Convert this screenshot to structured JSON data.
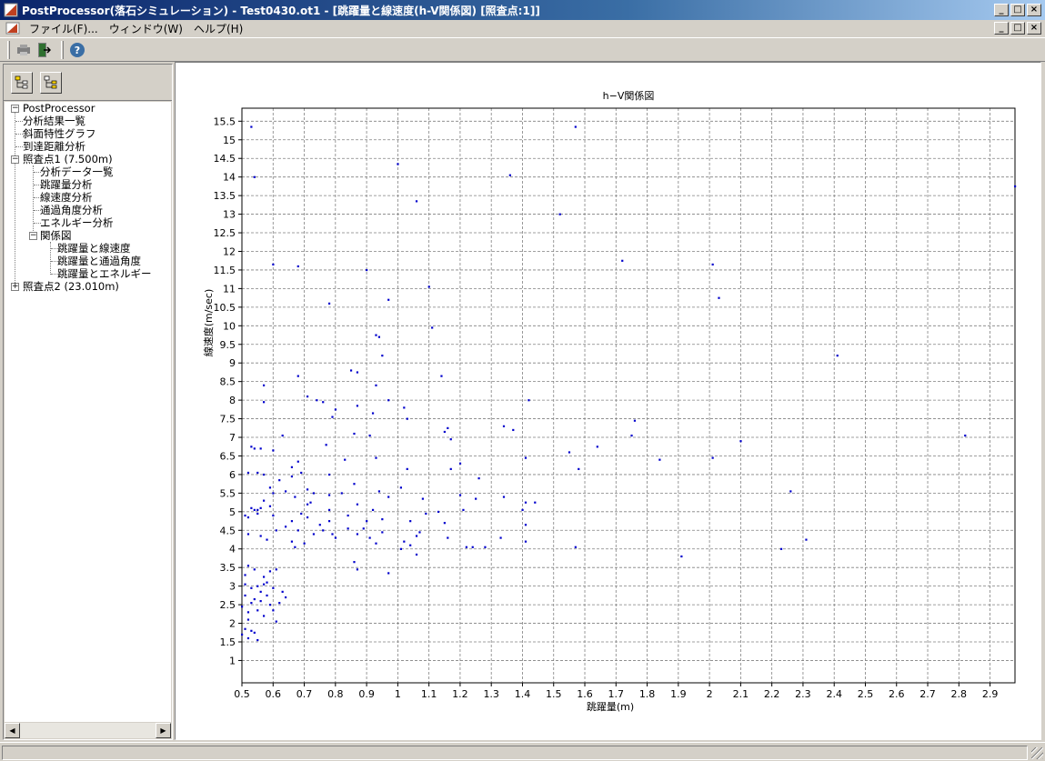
{
  "window": {
    "title": "PostProcessor(落石シミュレーション) - Test0430.ot1 - [跳躍量と線速度(h-V関係図) [照査点:1]]",
    "minimize": "_",
    "maximize": "□",
    "close": "×"
  },
  "menubar": {
    "items": [
      "ファイル(F)...",
      "ウィンドウ(W)",
      "ヘルプ(H)"
    ]
  },
  "toolbar": {
    "icons": [
      "print-icon",
      "exit-icon",
      "help-icon"
    ],
    "help_glyph": "?"
  },
  "tree": {
    "root": "PostProcessor",
    "items": [
      {
        "label": "分析結果一覧",
        "level": 1
      },
      {
        "label": "斜面特性グラフ",
        "level": 1
      },
      {
        "label": "到達距離分析",
        "level": 1
      },
      {
        "label": "照査点1 (7.500m)",
        "level": 1,
        "expanded": true
      },
      {
        "label": "分析データ一覧",
        "level": 2
      },
      {
        "label": "跳躍量分析",
        "level": 2
      },
      {
        "label": "線速度分析",
        "level": 2
      },
      {
        "label": "通過角度分析",
        "level": 2
      },
      {
        "label": "エネルギー分析",
        "level": 2
      },
      {
        "label": "関係図",
        "level": 2,
        "expanded": true
      },
      {
        "label": "跳躍量と線速度",
        "level": 3
      },
      {
        "label": "跳躍量と通過角度",
        "level": 3
      },
      {
        "label": "跳躍量とエネルギー",
        "level": 3
      },
      {
        "label": "照査点2 (23.010m)",
        "level": 1,
        "expanded": false
      }
    ],
    "toggle_expanded": "−",
    "toggle_collapsed": "+"
  },
  "colors": {
    "point": "#0000cc",
    "grid": "#808080",
    "titlebar": "#0a246a"
  },
  "chart_data": {
    "type": "scatter",
    "title": "h−V関係図",
    "xlabel": "跳躍量(m)",
    "ylabel": "線速度(m/sec)",
    "xlim": [
      0.5,
      2.98
    ],
    "ylim": [
      0.4,
      15.85
    ],
    "xticks": [
      "0.5",
      "0.6",
      "0.7",
      "0.8",
      "0.9",
      "1",
      "1.1",
      "1.2",
      "1.3",
      "1.4",
      "1.5",
      "1.6",
      "1.7",
      "1.8",
      "1.9",
      "2",
      "2.1",
      "2.2",
      "2.3",
      "2.4",
      "2.5",
      "2.6",
      "2.7",
      "2.8",
      "2.9"
    ],
    "yticks": [
      "1",
      "1.5",
      "2",
      "2.5",
      "3",
      "3.5",
      "4",
      "4.5",
      "5",
      "5.5",
      "6",
      "6.5",
      "7",
      "7.5",
      "8",
      "8.5",
      "9",
      "9.5",
      "10",
      "10.5",
      "11",
      "11.5",
      "12",
      "12.5",
      "13",
      "13.5",
      "14",
      "14.5",
      "15",
      "15.5"
    ],
    "grid": true,
    "points": [
      [
        0.53,
        15.35
      ],
      [
        1.57,
        15.35
      ],
      [
        0.54,
        14.0
      ],
      [
        1.0,
        14.35
      ],
      [
        1.36,
        14.05
      ],
      [
        1.06,
        13.35
      ],
      [
        1.52,
        13.0
      ],
      [
        2.98,
        13.75
      ],
      [
        0.6,
        11.65
      ],
      [
        0.68,
        11.6
      ],
      [
        0.9,
        11.5
      ],
      [
        1.1,
        11.05
      ],
      [
        1.72,
        11.75
      ],
      [
        2.01,
        11.65
      ],
      [
        2.03,
        10.75
      ],
      [
        0.97,
        10.7
      ],
      [
        0.78,
        10.6
      ],
      [
        1.11,
        9.95
      ],
      [
        0.93,
        9.75
      ],
      [
        0.94,
        9.7
      ],
      [
        0.95,
        9.2
      ],
      [
        2.41,
        9.2
      ],
      [
        0.85,
        8.8
      ],
      [
        0.87,
        8.75
      ],
      [
        1.14,
        8.65
      ],
      [
        0.68,
        8.65
      ],
      [
        0.57,
        8.4
      ],
      [
        0.93,
        8.4
      ],
      [
        0.71,
        8.1
      ],
      [
        0.74,
        8.0
      ],
      [
        0.76,
        7.95
      ],
      [
        0.97,
        8.0
      ],
      [
        1.42,
        8.0
      ],
      [
        0.57,
        7.95
      ],
      [
        0.87,
        7.85
      ],
      [
        1.02,
        7.8
      ],
      [
        0.8,
        7.75
      ],
      [
        0.92,
        7.65
      ],
      [
        0.79,
        7.55
      ],
      [
        1.03,
        7.5
      ],
      [
        1.76,
        7.45
      ],
      [
        1.34,
        7.3
      ],
      [
        1.16,
        7.25
      ],
      [
        1.37,
        7.2
      ],
      [
        0.63,
        7.05
      ],
      [
        0.86,
        7.1
      ],
      [
        1.15,
        7.15
      ],
      [
        1.75,
        7.05
      ],
      [
        2.82,
        7.05
      ],
      [
        0.91,
        7.05
      ],
      [
        2.1,
        6.9
      ],
      [
        0.77,
        6.8
      ],
      [
        1.17,
        6.95
      ],
      [
        1.64,
        6.75
      ],
      [
        0.53,
        6.75
      ],
      [
        0.56,
        6.7
      ],
      [
        0.54,
        6.7
      ],
      [
        0.6,
        6.65
      ],
      [
        1.55,
        6.6
      ],
      [
        1.41,
        6.45
      ],
      [
        2.01,
        6.45
      ],
      [
        1.84,
        6.4
      ],
      [
        0.83,
        6.4
      ],
      [
        0.93,
        6.45
      ],
      [
        0.66,
        6.2
      ],
      [
        0.68,
        6.35
      ],
      [
        1.2,
        6.3
      ],
      [
        0.52,
        6.05
      ],
      [
        0.55,
        6.05
      ],
      [
        0.57,
        6.0
      ],
      [
        0.78,
        6.0
      ],
      [
        0.69,
        6.05
      ],
      [
        1.03,
        6.15
      ],
      [
        1.17,
        6.15
      ],
      [
        1.58,
        6.15
      ],
      [
        0.66,
        5.95
      ],
      [
        0.62,
        5.85
      ],
      [
        0.86,
        5.75
      ],
      [
        1.26,
        5.9
      ],
      [
        0.71,
        5.6
      ],
      [
        0.59,
        5.65
      ],
      [
        0.6,
        5.5
      ],
      [
        0.64,
        5.55
      ],
      [
        0.67,
        5.4
      ],
      [
        0.73,
        5.5
      ],
      [
        0.78,
        5.45
      ],
      [
        0.82,
        5.5
      ],
      [
        0.94,
        5.55
      ],
      [
        0.97,
        5.4
      ],
      [
        1.01,
        5.65
      ],
      [
        1.08,
        5.35
      ],
      [
        1.2,
        5.45
      ],
      [
        1.25,
        5.35
      ],
      [
        1.34,
        5.4
      ],
      [
        2.26,
        5.55
      ],
      [
        0.57,
        5.3
      ],
      [
        0.53,
        5.1
      ],
      [
        0.54,
        5.05
      ],
      [
        0.55,
        5.05
      ],
      [
        0.56,
        5.1
      ],
      [
        0.59,
        5.15
      ],
      [
        0.71,
        5.2
      ],
      [
        0.72,
        5.25
      ],
      [
        0.78,
        5.05
      ],
      [
        0.87,
        5.2
      ],
      [
        0.92,
        5.05
      ],
      [
        1.09,
        4.95
      ],
      [
        1.21,
        5.05
      ],
      [
        1.41,
        5.25
      ],
      [
        1.44,
        5.25
      ],
      [
        0.51,
        4.9
      ],
      [
        0.52,
        4.85
      ],
      [
        0.55,
        4.95
      ],
      [
        0.6,
        4.9
      ],
      [
        0.66,
        4.75
      ],
      [
        0.69,
        4.95
      ],
      [
        0.71,
        4.85
      ],
      [
        0.75,
        4.65
      ],
      [
        0.78,
        4.75
      ],
      [
        0.84,
        4.9
      ],
      [
        0.9,
        4.75
      ],
      [
        0.95,
        4.8
      ],
      [
        1.04,
        4.75
      ],
      [
        1.13,
        5.0
      ],
      [
        1.4,
        5.05
      ],
      [
        0.64,
        4.6
      ],
      [
        0.68,
        4.5
      ],
      [
        0.73,
        4.4
      ],
      [
        0.76,
        4.5
      ],
      [
        0.79,
        4.4
      ],
      [
        0.84,
        4.55
      ],
      [
        0.89,
        4.55
      ],
      [
        0.95,
        4.45
      ],
      [
        1.07,
        4.45
      ],
      [
        1.15,
        4.7
      ],
      [
        1.41,
        4.65
      ],
      [
        0.52,
        4.4
      ],
      [
        0.56,
        4.35
      ],
      [
        0.58,
        4.25
      ],
      [
        0.61,
        4.5
      ],
      [
        0.66,
        4.2
      ],
      [
        0.7,
        4.15
      ],
      [
        0.8,
        4.3
      ],
      [
        0.87,
        4.4
      ],
      [
        0.91,
        4.3
      ],
      [
        0.93,
        4.15
      ],
      [
        1.02,
        4.2
      ],
      [
        1.04,
        4.1
      ],
      [
        1.06,
        4.35
      ],
      [
        1.16,
        4.3
      ],
      [
        1.24,
        4.05
      ],
      [
        1.28,
        4.05
      ],
      [
        1.33,
        4.3
      ],
      [
        1.41,
        4.2
      ],
      [
        0.67,
        4.05
      ],
      [
        1.01,
        4.0
      ],
      [
        1.06,
        3.85
      ],
      [
        1.22,
        4.05
      ],
      [
        1.57,
        4.05
      ],
      [
        2.23,
        4.0
      ],
      [
        2.31,
        4.25
      ],
      [
        1.91,
        3.8
      ],
      [
        0.86,
        3.65
      ],
      [
        0.87,
        3.45
      ],
      [
        0.97,
        3.35
      ],
      [
        0.52,
        3.55
      ],
      [
        0.54,
        3.45
      ],
      [
        0.57,
        3.25
      ],
      [
        0.59,
        3.4
      ],
      [
        0.61,
        3.45
      ],
      [
        0.51,
        3.3
      ],
      [
        0.55,
        3.0
      ],
      [
        0.57,
        3.05
      ],
      [
        0.6,
        2.95
      ],
      [
        0.63,
        2.85
      ],
      [
        0.64,
        2.7
      ],
      [
        0.58,
        2.75
      ],
      [
        0.56,
        2.6
      ],
      [
        0.53,
        2.55
      ],
      [
        0.55,
        2.35
      ],
      [
        0.57,
        2.2
      ],
      [
        0.6,
        2.35
      ],
      [
        0.61,
        2.05
      ],
      [
        0.59,
        2.5
      ],
      [
        0.52,
        2.1
      ],
      [
        0.51,
        1.85
      ],
      [
        0.52,
        1.6
      ],
      [
        0.54,
        1.75
      ],
      [
        0.55,
        1.55
      ],
      [
        0.53,
        1.8
      ],
      [
        0.51,
        2.75
      ],
      [
        0.53,
        2.95
      ],
      [
        0.54,
        2.65
      ],
      [
        0.56,
        2.85
      ],
      [
        0.58,
        3.1
      ],
      [
        0.52,
        2.3
      ],
      [
        0.5,
        2.45
      ],
      [
        0.5,
        1.7
      ],
      [
        0.51,
        3.05
      ],
      [
        0.62,
        2.55
      ]
    ]
  }
}
